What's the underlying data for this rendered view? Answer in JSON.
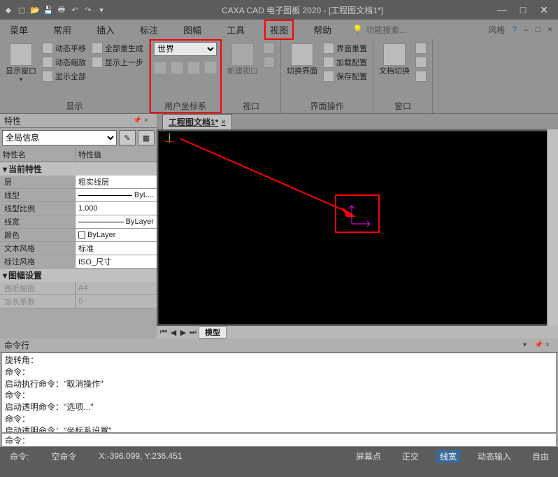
{
  "titlebar": {
    "title": "CAXA CAD 电子图板 2020 - [工程图文档1*]"
  },
  "menu": {
    "items": [
      "菜单",
      "常用",
      "插入",
      "标注",
      "图幅",
      "工具",
      "视图",
      "帮助"
    ],
    "active_index": 6,
    "search_hint": "功能搜索...",
    "style_label": "风格"
  },
  "ribbon": {
    "display": {
      "group_label": "显示",
      "show_window": "显示窗口",
      "pan": "动态平移",
      "zoom": "动态缩放",
      "show_all": "显示全部",
      "regen_all": "全部重生成",
      "show_prev": "显示上一步"
    },
    "ucs": {
      "group_label": "用户坐标系",
      "world_option": "世界"
    },
    "viewport": {
      "group_label": "视口",
      "new_viewport": "新建视口"
    },
    "interface": {
      "group_label": "界面操作",
      "switch_ui": "切换界面",
      "reset_ui": "界面重置",
      "load_cfg": "加载配置",
      "save_cfg": "保存配置"
    },
    "window": {
      "group_label": "窗口",
      "doc_switch": "文档切换"
    }
  },
  "props": {
    "panel_title": "特性",
    "selector": "全局信息",
    "col_name": "特性名",
    "col_value": "特性值",
    "section_current": "当前特性",
    "rows": [
      {
        "k": "层",
        "v": "粗实线层"
      },
      {
        "k": "线型",
        "v": "ByL..."
      },
      {
        "k": "线型比例",
        "v": "1.000"
      },
      {
        "k": "线宽",
        "v": "ByLayer"
      },
      {
        "k": "颜色",
        "v": "ByLayer"
      },
      {
        "k": "文本风格",
        "v": "标准"
      },
      {
        "k": "标注风格",
        "v": "ISO_尺寸"
      }
    ],
    "section_sheet": "图幅设置",
    "sheet_rows": [
      {
        "k": "图纸幅面",
        "v": "A4"
      },
      {
        "k": "加长系数",
        "v": "0"
      }
    ]
  },
  "doc": {
    "tab_label": "工程图文档1*",
    "model_tab": "模型"
  },
  "cmd": {
    "panel_title": "命令行",
    "log": [
      "旋转角：",
      "命令：",
      "启动执行命令：\"取消操作\"",
      "命令：",
      "启动透明命令：\"选项...\"",
      "命令：",
      "启动透明命令：\"坐标系设置\""
    ],
    "prompt": "命令："
  },
  "status": {
    "cmd_label": "命令:",
    "empty_cmd": "空命令",
    "coords": "X:-396.099, Y:236.451",
    "screen_point": "屏幕点",
    "ortho": "正交",
    "lineweight": "线宽",
    "dyn_input": "动态输入",
    "free": "自由"
  }
}
